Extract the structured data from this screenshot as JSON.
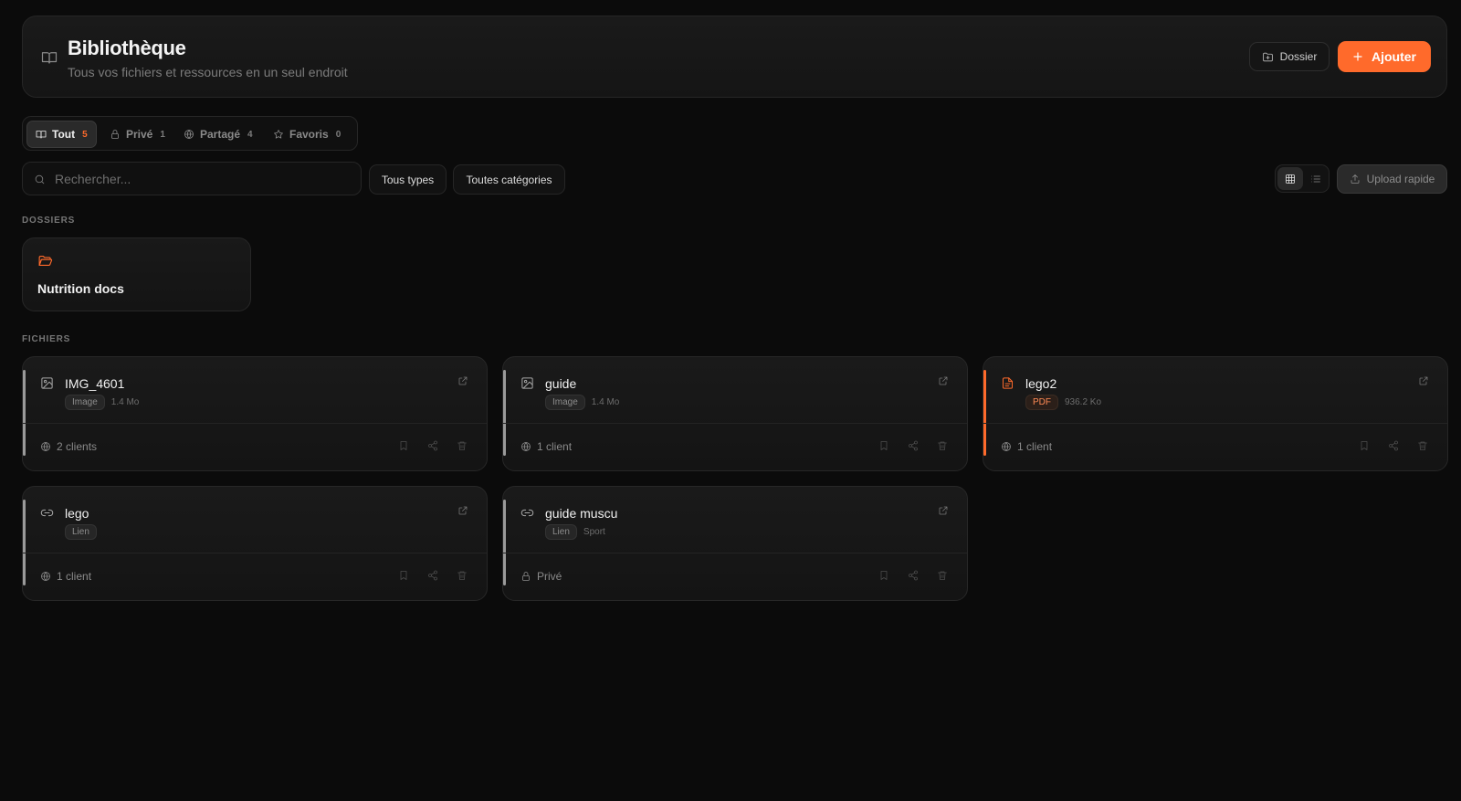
{
  "header": {
    "title": "Bibliothèque",
    "subtitle": "Tous vos fichiers et ressources en un seul endroit",
    "folder_button": "Dossier",
    "add_button": "Ajouter"
  },
  "tabs": [
    {
      "label": "Tout",
      "count": "5",
      "icon": "book-icon",
      "active": true
    },
    {
      "label": "Privé",
      "count": "1",
      "icon": "lock-icon",
      "active": false
    },
    {
      "label": "Partagé",
      "count": "4",
      "icon": "globe-icon",
      "active": false
    },
    {
      "label": "Favoris",
      "count": "0",
      "icon": "star-icon",
      "active": false
    }
  ],
  "filters": {
    "search_placeholder": "Rechercher...",
    "type_select": "Tous types",
    "category_select": "Toutes catégories",
    "view_mode": "grid",
    "upload_button": "Upload rapide"
  },
  "sections": {
    "folders": "DOSSIERS",
    "files": "FICHIERS"
  },
  "folders": [
    {
      "name": "Nutrition docs"
    }
  ],
  "files": [
    {
      "name": "IMG_4601",
      "type": "Image",
      "size": "1.4 Mo",
      "sharing": "2 clients",
      "icon": "image-icon",
      "accent": "#9a9a9a"
    },
    {
      "name": "guide",
      "type": "Image",
      "size": "1.4 Mo",
      "sharing": "1 client",
      "icon": "image-icon",
      "accent": "#9a9a9a"
    },
    {
      "name": "lego2",
      "type": "PDF",
      "size": "936.2 Ko",
      "sharing": "1 client",
      "icon": "pdf-file-icon",
      "accent": "#ff6a2b"
    },
    {
      "name": "lego",
      "type": "Lien",
      "size": "",
      "sharing": "1 client",
      "icon": "link-icon",
      "accent": "#9a9a9a"
    },
    {
      "name": "guide muscu",
      "type": "Lien",
      "size": "Sport",
      "sharing": "Privé",
      "icon": "link-icon",
      "accent": "#9a9a9a"
    }
  ],
  "colors": {
    "accent": "#ff6a2b",
    "background": "#0b0b0b"
  }
}
